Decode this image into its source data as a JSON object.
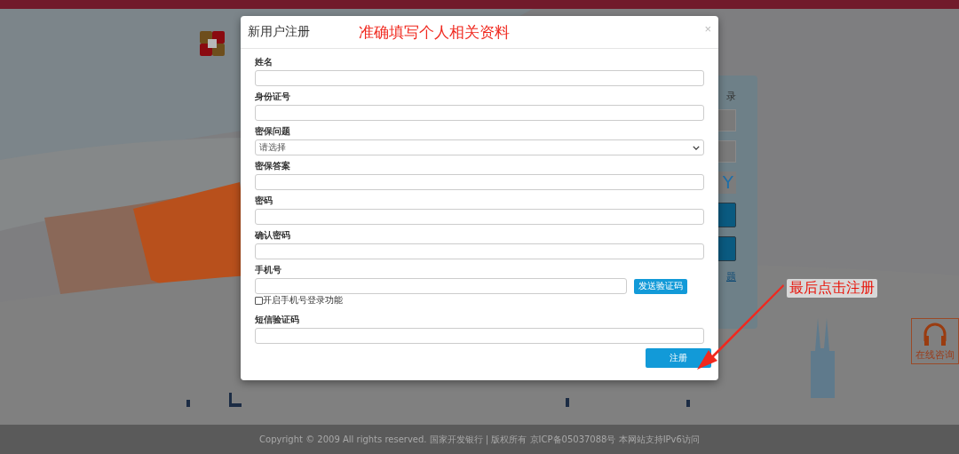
{
  "modal": {
    "title": "新用户注册",
    "close": "×",
    "fields": [
      {
        "label": "姓名",
        "kind": "text"
      },
      {
        "label": "身份证号",
        "kind": "text"
      },
      {
        "label": "密保问题",
        "kind": "select",
        "placeholder": "请选择"
      },
      {
        "label": "密保答案",
        "kind": "text"
      },
      {
        "label": "密码",
        "kind": "text"
      },
      {
        "label": "确认密码",
        "kind": "text"
      },
      {
        "label": "手机号",
        "kind": "phone",
        "button": "发送验证码",
        "checkbox": {
          "label": "开启手机号登录功能",
          "checked": false
        }
      },
      {
        "label": "短信验证码",
        "kind": "text"
      }
    ],
    "submit": "注册"
  },
  "annotations": [
    {
      "text": "准确填写个人相关资料",
      "kind": "note"
    },
    {
      "text": "最后点击注册",
      "kind": "callout"
    }
  ],
  "login_panel": {
    "title": "录",
    "captcha": "Y",
    "link": "题"
  },
  "consult": "在线咨询",
  "footer": "Copyright © 2009 All rights reserved. 国家开发银行 | 版权所有 京ICP备05037088号 本网站支持IPv6访问"
}
